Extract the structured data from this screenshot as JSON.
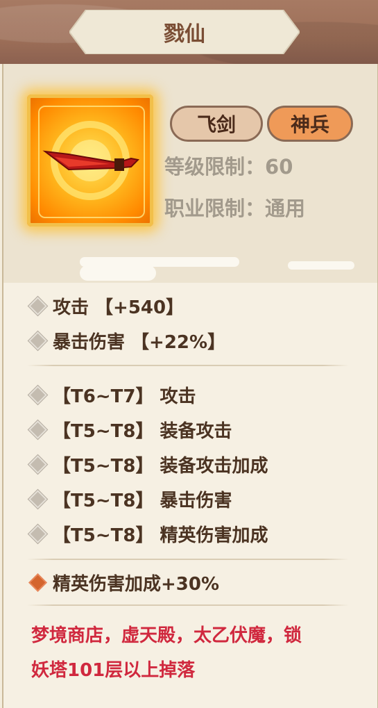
{
  "header": {
    "title": "戮仙"
  },
  "item": {
    "icon": "flame-sword-icon",
    "tags": [
      "飞剑",
      "神兵"
    ],
    "level_label": "等级限制：",
    "level_value": "60",
    "class_label": "职业限制：",
    "class_value": "通用"
  },
  "base_stats": [
    "攻击 【+540】",
    "暴击伤害 【+22%】"
  ],
  "tier_stats": [
    "【T6~T7】 攻击",
    "【T5~T8】 装备攻击",
    "【T5~T8】 装备攻击加成",
    "【T5~T8】 暴击伤害",
    "【T5~T8】 精英伤害加成"
  ],
  "special_stat": "精英伤害加成+30%",
  "source": {
    "line1": "梦境商店，虚天殿，太乙伏魔，锁",
    "line2": "妖塔101层以上掉落"
  },
  "colors": {
    "header_wood": "#9d6f58",
    "tag_active": "#ef9a58",
    "source_text": "#d0283e",
    "special_diamond": "#d4652e"
  }
}
